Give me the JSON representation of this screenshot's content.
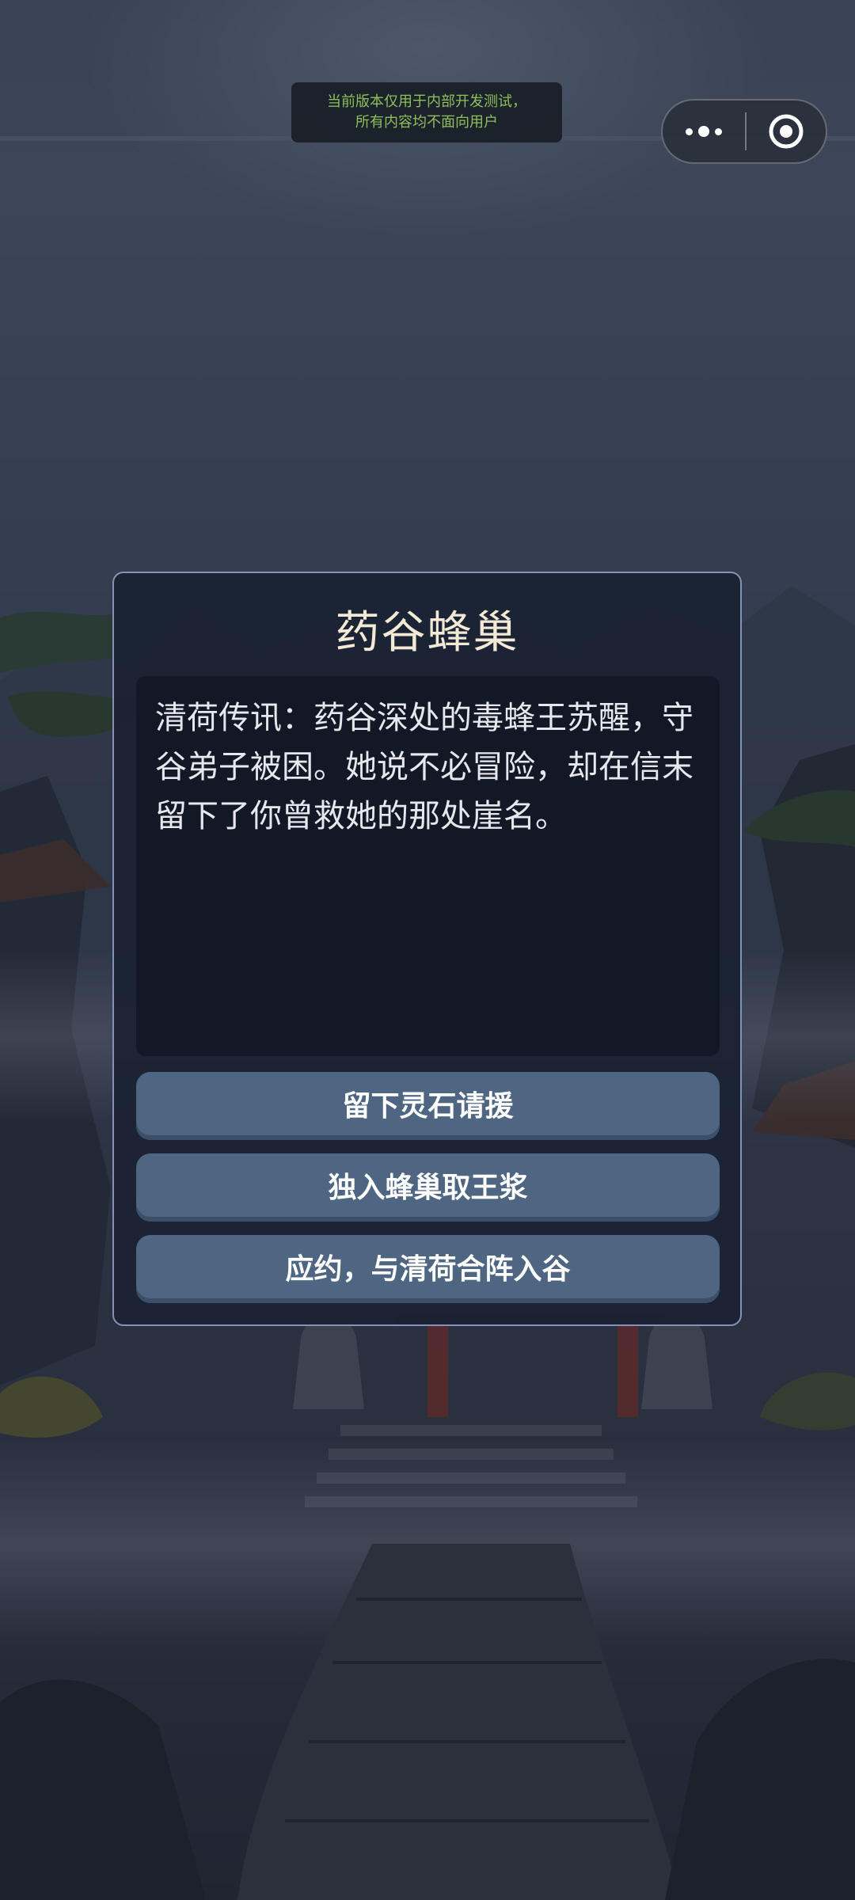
{
  "dev_notice": {
    "line1": "当前版本仅用于内部开发测试，",
    "line2": "所有内容均不面向用户"
  },
  "capsule": {
    "more_icon": "more-dots-icon",
    "close_icon": "target-circle-icon"
  },
  "dialog": {
    "title": "药谷蜂巢",
    "story": "清荷传讯：药谷深处的毒蜂王苏醒，守谷弟子被困。她说不必冒险，却在信末留下了你曾救她的那处崖名。",
    "choices": [
      {
        "label": "留下灵石请援"
      },
      {
        "label": "独入蜂巢取王浆"
      },
      {
        "label": "应约，与清荷合阵入谷"
      }
    ]
  },
  "colors": {
    "dialog_bg": "#1b2334",
    "dialog_border": "#8592b5",
    "story_bg": "#121826",
    "choice_bg": "#4e6682",
    "title_text": "#f3ead6",
    "notice_text": "#8fbf5a"
  }
}
